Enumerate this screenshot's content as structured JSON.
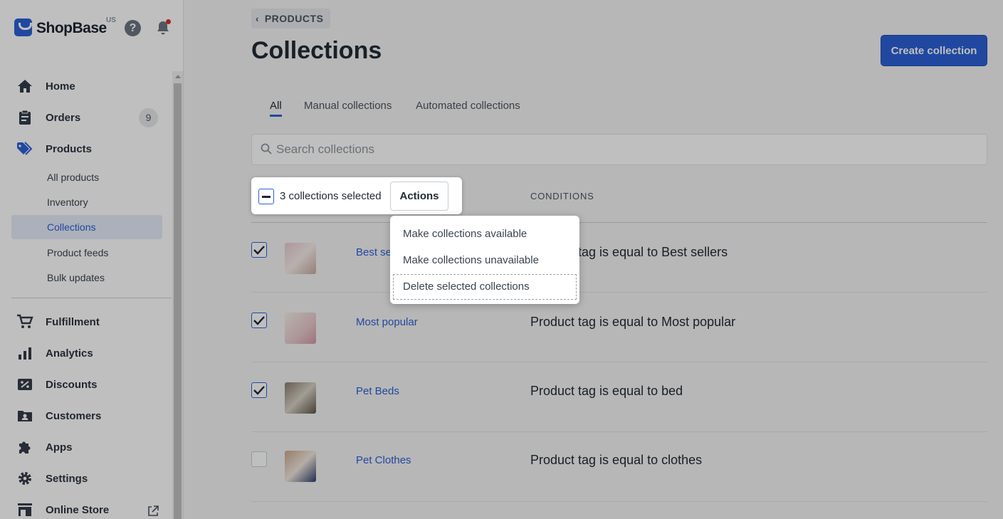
{
  "app": {
    "brand": "ShopBase",
    "region": "US"
  },
  "sidebar": {
    "nav": [
      {
        "label": "Home",
        "icon": "home-icon"
      },
      {
        "label": "Orders",
        "icon": "clipboard-icon",
        "badge": "9"
      },
      {
        "label": "Products",
        "icon": "tag-icon"
      }
    ],
    "sub": [
      {
        "label": "All products"
      },
      {
        "label": "Inventory"
      },
      {
        "label": "Collections"
      },
      {
        "label": "Product feeds"
      },
      {
        "label": "Bulk updates"
      }
    ],
    "nav2": [
      {
        "label": "Fulfillment",
        "icon": "cart-icon"
      },
      {
        "label": "Analytics",
        "icon": "bar-chart-icon"
      },
      {
        "label": "Discounts",
        "icon": "percent-tag-icon"
      },
      {
        "label": "Customers",
        "icon": "customer-folder-icon"
      },
      {
        "label": "Apps",
        "icon": "puzzle-icon"
      },
      {
        "label": "Settings",
        "icon": "gear-icon"
      },
      {
        "label": "Online Store",
        "icon": "store-icon"
      }
    ]
  },
  "header": {
    "breadcrumb": "PRODUCTS",
    "title": "Collections",
    "create_label": "Create collection"
  },
  "tabs": [
    {
      "label": "All"
    },
    {
      "label": "Manual collections"
    },
    {
      "label": "Automated collections"
    }
  ],
  "search": {
    "placeholder": "Search collections",
    "value": ""
  },
  "table": {
    "conditions_header": "CONDITIONS",
    "rows": [
      {
        "name": "Best se",
        "condition": "Product tag is equal to Best sellers",
        "checked": true
      },
      {
        "name": "Most popular",
        "condition": "Product tag is equal to Most popular",
        "checked": true
      },
      {
        "name": "Pet Beds",
        "condition": "Product tag is equal to bed",
        "checked": true
      },
      {
        "name": "Pet Clothes",
        "condition": "Product tag is equal to clothes",
        "checked": false
      }
    ]
  },
  "bulk": {
    "selected_text": "3 collections selected",
    "actions_label": "Actions"
  },
  "dropdown": {
    "items": [
      {
        "label": "Make collections available"
      },
      {
        "label": "Make collections unavailable"
      },
      {
        "label": "Delete selected collections"
      }
    ]
  },
  "colors": {
    "accent": "#2c60d6",
    "notification": "#d32f2f"
  }
}
